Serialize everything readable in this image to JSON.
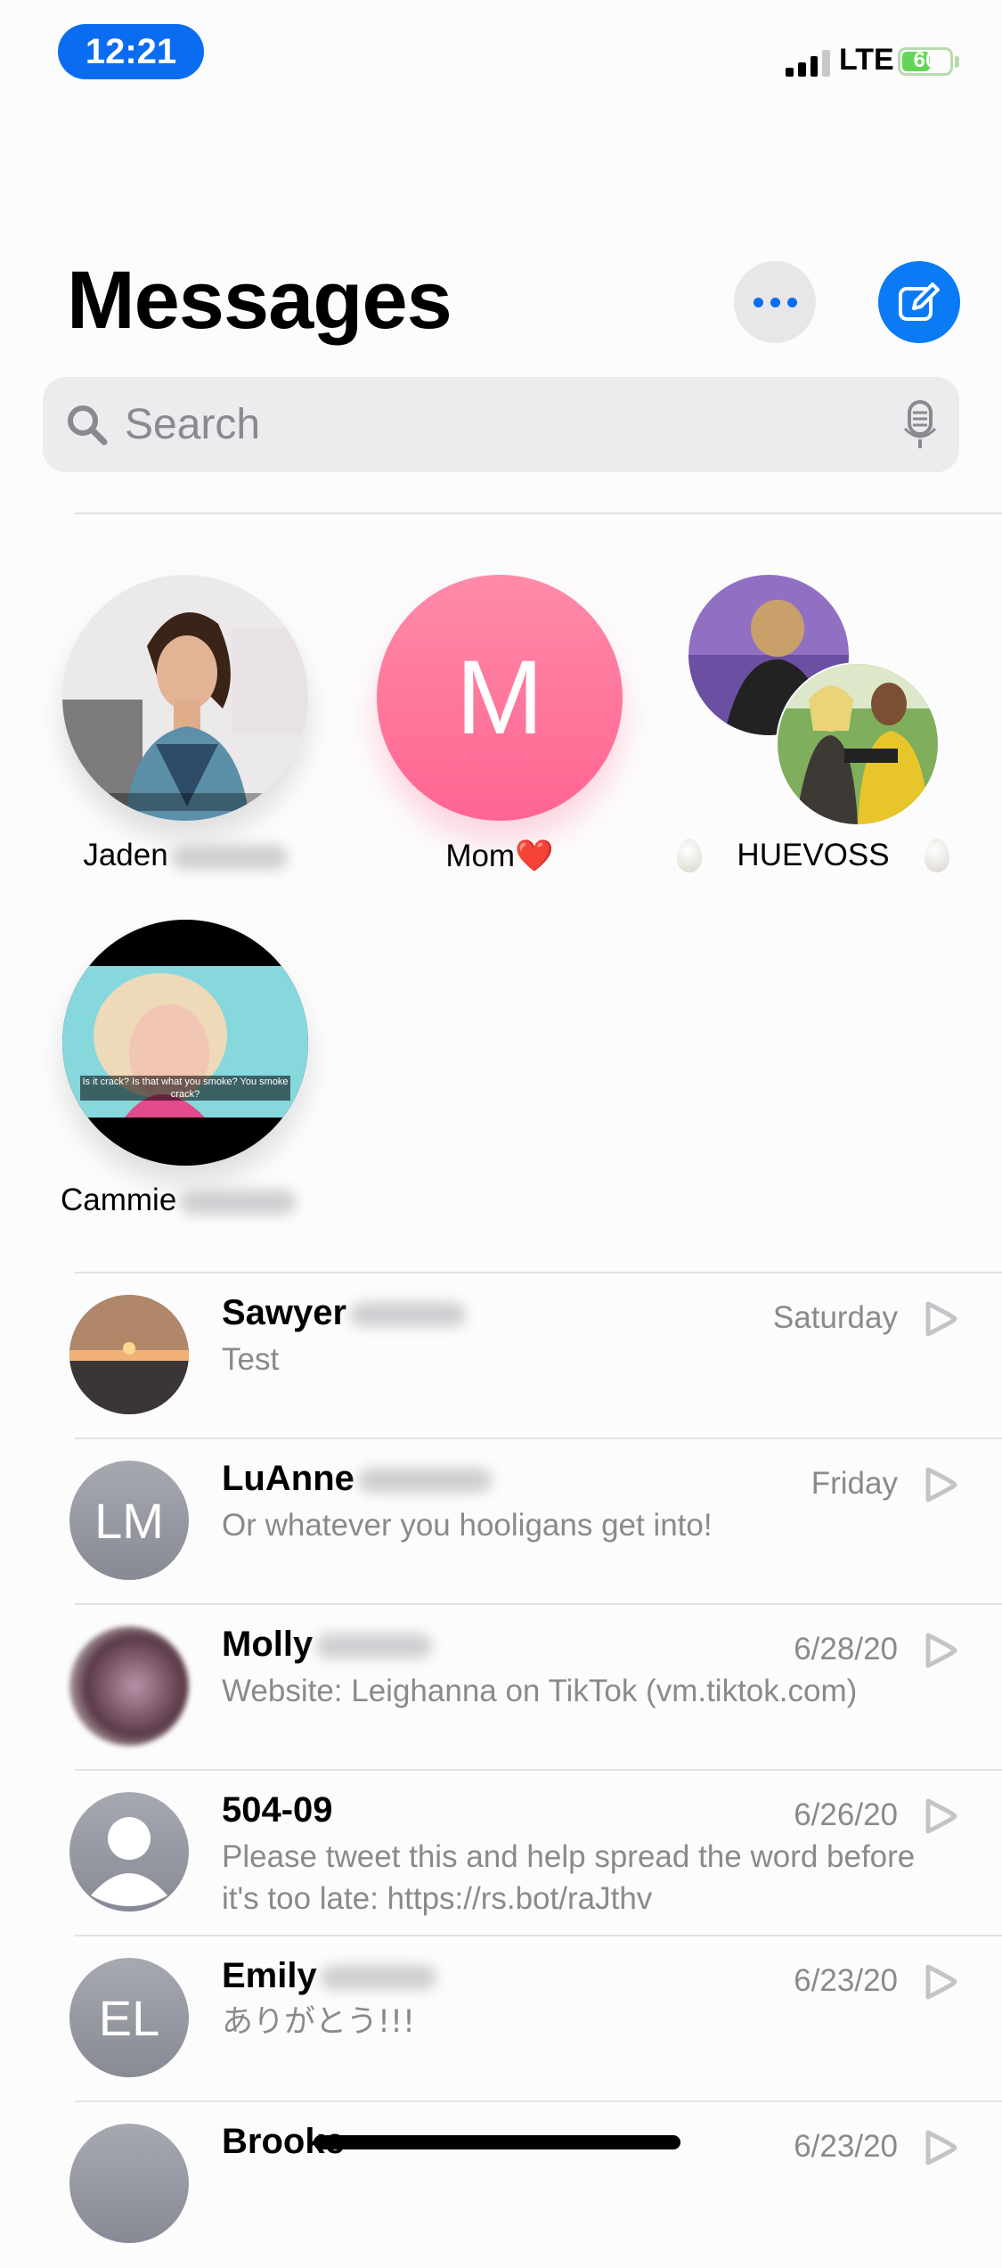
{
  "status": {
    "time": "12:21",
    "network": "LTE",
    "battery": "60",
    "battery_level": 0.6
  },
  "header": {
    "title": "Messages"
  },
  "search": {
    "placeholder": "Search"
  },
  "pinned": [
    {
      "name": "Jaden"
    },
    {
      "name": "Mom",
      "emoji": "❤️"
    },
    {
      "name": "HUEVOSS"
    },
    {
      "name": "Cammie",
      "caption": "Is it crack? Is that what you smoke? You smoke crack?"
    }
  ],
  "conversations": [
    {
      "name": "Sawyer",
      "date": "Saturday",
      "message": "Test"
    },
    {
      "name": "LuAnne",
      "initials": "LM",
      "date": "Friday",
      "message": "Or whatever you hooligans get into!"
    },
    {
      "name": "Molly",
      "date": "6/28/20",
      "message": "Website: Leighanna on TikTok (vm.tiktok.com)"
    },
    {
      "name": "504-09",
      "date": "6/26/20",
      "message": "Please tweet this and help spread the word before it's too late: https://rs.bot/raJthv"
    },
    {
      "name": "Emily",
      "initials": "EL",
      "date": "6/23/20",
      "message": "ありがとう!!!"
    },
    {
      "name": "Brooke",
      "date": "6/23/20",
      "message": ""
    }
  ],
  "colors": {
    "accent": "#0a7bf5",
    "mom_avatar": "#ff6f97"
  },
  "icons": [
    "more-icon",
    "compose-icon",
    "search-icon",
    "mic-icon",
    "chevron-icon",
    "person-icon"
  ]
}
